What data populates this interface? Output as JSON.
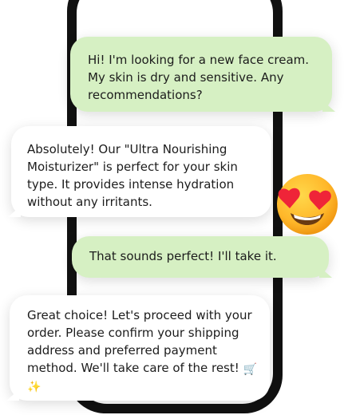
{
  "chat": {
    "messages": [
      {
        "direction": "outgoing",
        "text": "Hi! I'm looking for a new face cream. My skin is dry and sensitive. Any recommendations?"
      },
      {
        "direction": "incoming",
        "text": "Absolutely! Our \"Ultra Nourishing Moisturizer\" is perfect for your skin type. It provides intense hydration without any irritants."
      },
      {
        "direction": "outgoing",
        "text": "That sounds perfect! I'll take it."
      },
      {
        "direction": "incoming",
        "text": "Great choice! Let's proceed with your order. Please confirm your shipping address and preferred payment method. We'll take care of the rest!",
        "trailing_emoji": "🛒✨"
      }
    ],
    "reaction_emoji": "heart-eyes-emoji"
  },
  "colors": {
    "outgoing_bubble": "#d6f0c3",
    "incoming_bubble": "#ffffff",
    "phone_frame": "#111111",
    "text": "#1c1c1c"
  }
}
